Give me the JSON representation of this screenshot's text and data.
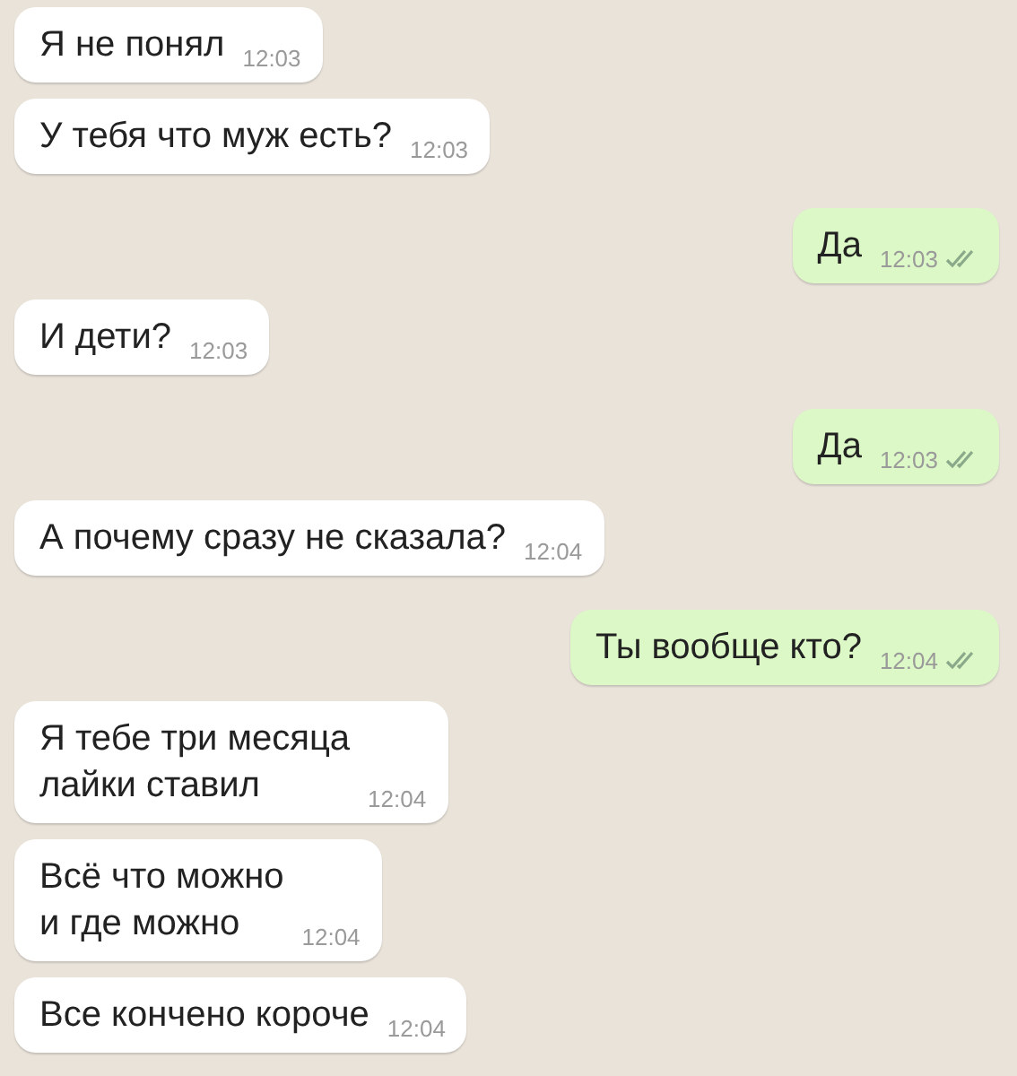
{
  "messages": [
    {
      "kind": "incoming",
      "text": "Я не понял",
      "time": "12:03"
    },
    {
      "kind": "incoming",
      "text": "У тебя что муж есть?",
      "time": "12:03"
    },
    {
      "kind": "outgoing",
      "text": "Да",
      "time": "12:03",
      "read": true
    },
    {
      "kind": "incoming",
      "text": "И дети?",
      "time": "12:03"
    },
    {
      "kind": "outgoing",
      "text": "Да",
      "time": "12:03",
      "read": true
    },
    {
      "kind": "incoming",
      "text": "А почему сразу не сказала?",
      "time": "12:04"
    },
    {
      "kind": "outgoing",
      "text": "Ты вообще кто?",
      "time": "12:04",
      "read": true
    },
    {
      "kind": "incoming",
      "text": "Я тебе три месяца\nлайки ставил",
      "time": "12:04"
    },
    {
      "kind": "incoming",
      "text": "Всё что можно\nи где можно",
      "time": "12:04"
    },
    {
      "kind": "incoming",
      "text": "Все кончено короче",
      "time": "12:04"
    }
  ]
}
